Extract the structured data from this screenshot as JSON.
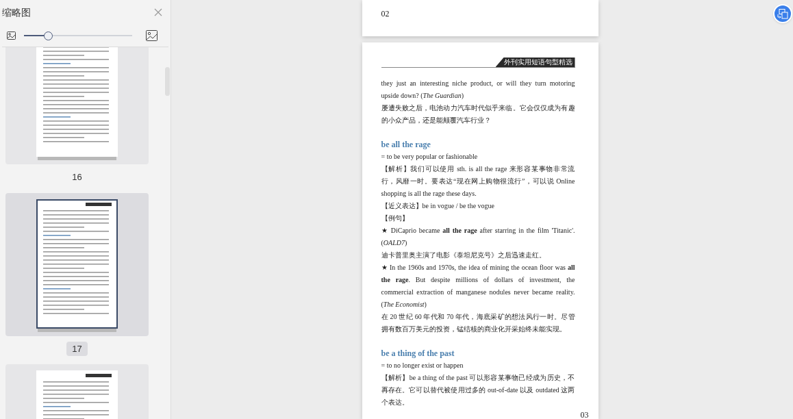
{
  "sidebar": {
    "title": "缩略图",
    "zoom": {
      "level": 0.22
    },
    "thumbnails": [
      {
        "label": "16",
        "selected": false
      },
      {
        "label": "17",
        "selected": true
      },
      {
        "selected": false
      }
    ]
  },
  "previous_page": {
    "page_number": "02"
  },
  "current_page": {
    "header": "外刊实用短语句型精选",
    "blocks": [
      {
        "kind": "text",
        "text": "they just an interesting niche product, or will they turn motoring upside down? (*The Guardian*)"
      },
      {
        "kind": "text",
        "text": "屡遭失败之后，电池动力汽车时代似乎来临。它会仅仅成为有趣的小众产品，还是能颠覆汽车行业？"
      },
      {
        "kind": "heading",
        "text": "be all the rage"
      },
      {
        "kind": "text",
        "text": "= to be very popular or fashionable"
      },
      {
        "kind": "text",
        "text": "【解析】我们可以使用 sth. is all the rage 来形容某事物非常流行，风靡一时。要表达“现在网上购物很流行”，可以说 Online shopping is all the rage these days."
      },
      {
        "kind": "text",
        "text": "【近义表达】be in vogue / be the vogue"
      },
      {
        "kind": "text",
        "text": "【例句】"
      },
      {
        "kind": "text",
        "text": "★ DiCaprio became **all the rage** after starring in the film 'Titanic'. (*OALD7*)"
      },
      {
        "kind": "text",
        "text": "迪卡普里奥主演了电影《泰坦尼克号》之后迅速走红。"
      },
      {
        "kind": "text",
        "text": "★ In the 1960s and 1970s, the idea of mining the ocean floor was **all the rage**. But despite millions of dollars of investment, the commercial extraction of manganese nodules never became reality. (*The Economist*)"
      },
      {
        "kind": "text",
        "text": "在 20 世纪 60 年代和 70 年代，海底采矿的想法风行一时。尽管拥有数百万美元的投资，锰结核的商业化开采始终未能实现。"
      },
      {
        "kind": "heading",
        "text": "be a thing of the past"
      },
      {
        "kind": "text",
        "text": "= to no longer exist or happen"
      },
      {
        "kind": "text",
        "text": "【解析】be a thing of the past 可以形容某事物已经成为历史，不再存在。它可以替代被使用过多的 out-of-date 以及 outdated 这两个表达。"
      }
    ],
    "page_number": "03"
  }
}
